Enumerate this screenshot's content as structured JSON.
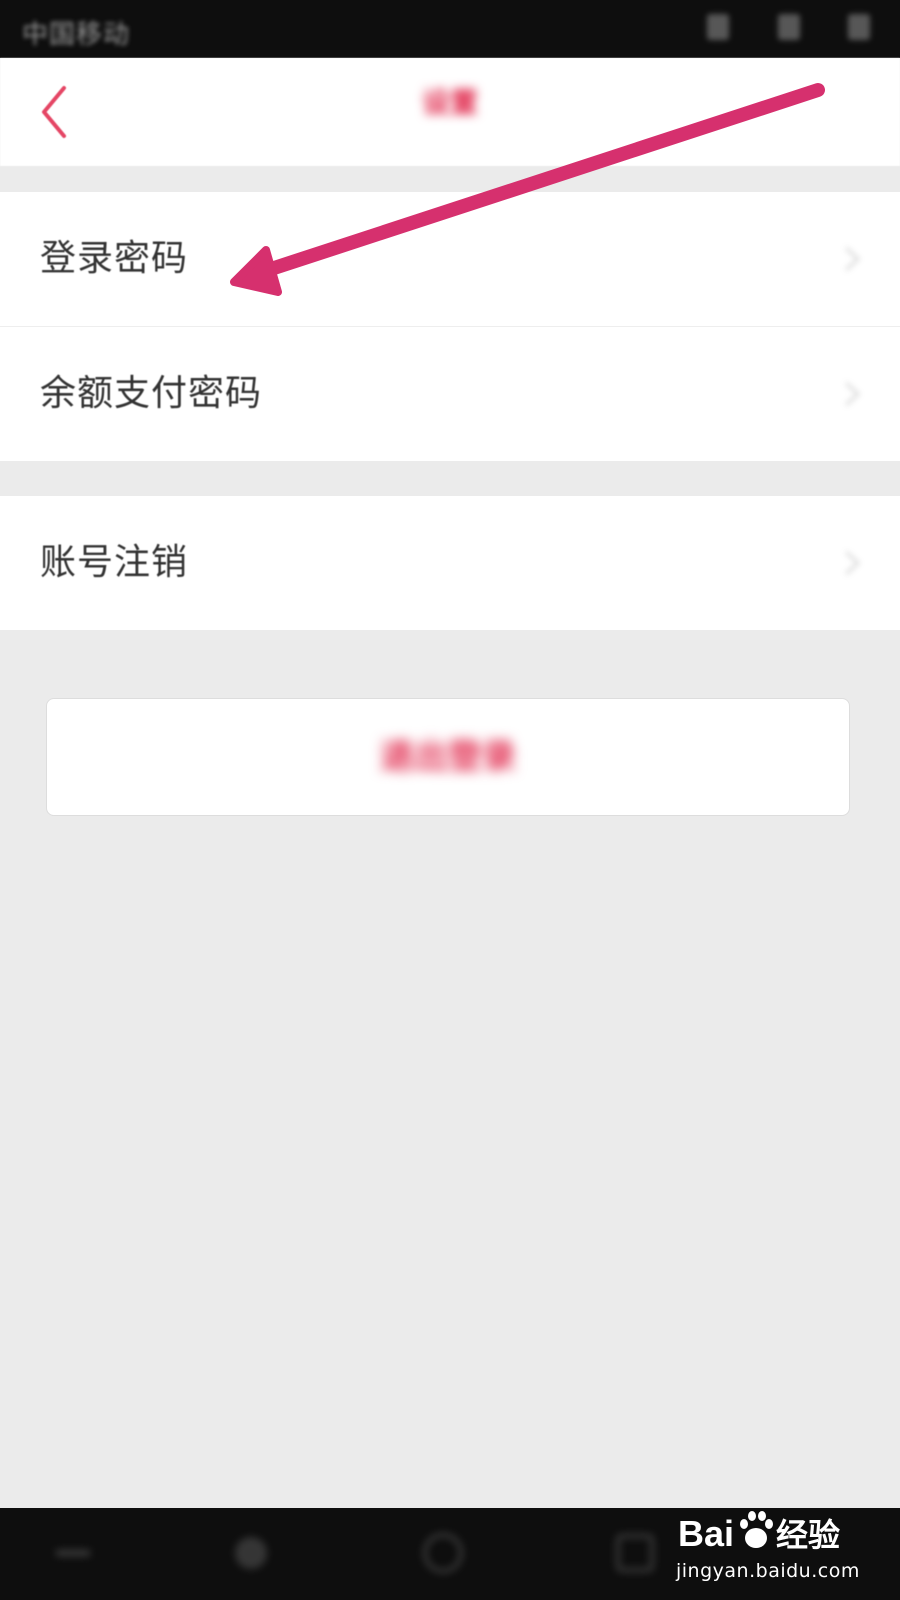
{
  "status_bar": {
    "carrier": "中国移动"
  },
  "header": {
    "back_icon": "chevron-left-icon",
    "title": "设置"
  },
  "settings": {
    "group1": [
      {
        "label": "登录密码"
      },
      {
        "label": "余额支付密码"
      }
    ],
    "group2": [
      {
        "label": "账号注销"
      }
    ]
  },
  "logout_button": {
    "label": "退出登录"
  },
  "watermark": {
    "logo_text": "Bai经验",
    "url": "jingyan.baidu.com"
  },
  "colors": {
    "accent": "#e0264a",
    "arrow": "#d6306e",
    "background": "#ebebeb",
    "text": "#333333"
  }
}
